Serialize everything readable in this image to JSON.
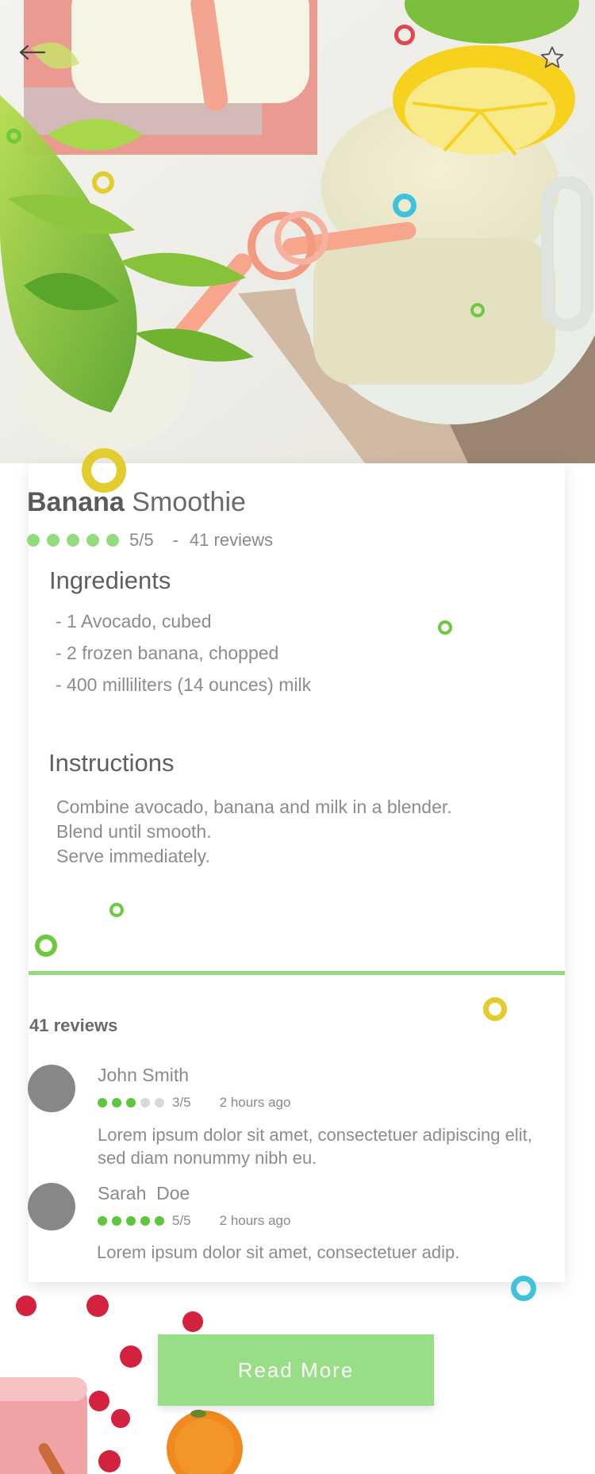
{
  "recipe": {
    "name_bold": "Banana",
    "name_light": "Smoothie",
    "rating": 5,
    "rating_text": "5/5",
    "separator": "-",
    "review_count_text": "41 reviews"
  },
  "ingredients": {
    "title": "Ingredients",
    "items": [
      "- 1 Avocado, cubed",
      "- 2 frozen banana, chopped",
      "- 400 milliliters (14 ounces) milk"
    ]
  },
  "instructions": {
    "title": "Instructions",
    "steps": [
      "Combine avocado, banana and milk in a blender.",
      "Blend until smooth.",
      "Serve immediately."
    ]
  },
  "reviews": {
    "title": "41 reviews",
    "items": [
      {
        "name": "John Smith",
        "stars": 3,
        "score": "3/5",
        "time": "2 hours ago",
        "text": "Lorem ipsum dolor sit amet, consectetuer adipiscing elit, sed diam nonummy nibh eu."
      },
      {
        "name": "Sarah  Doe",
        "stars": 5,
        "score": "5/5",
        "time": "2 hours ago",
        "text": "Lorem ipsum dolor sit amet, consectetuer adip."
      }
    ]
  },
  "actions": {
    "read_more": "Read More"
  },
  "icons": {
    "back": "arrow-left-icon",
    "favorite": "star-outline-icon"
  },
  "colors": {
    "accent_green": "#92dc7e",
    "button_green": "#97de86",
    "star_green": "#5ec63d",
    "ring_red": "#e0484f",
    "ring_yellow": "#e3cc2e",
    "ring_cyan": "#3fc3dc",
    "ring_green": "#6ec93e",
    "avatar_gray": "#878787"
  }
}
